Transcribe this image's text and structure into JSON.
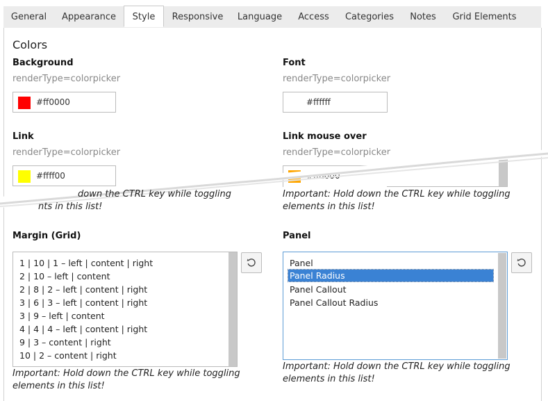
{
  "tabs": [
    {
      "label": "General"
    },
    {
      "label": "Appearance"
    },
    {
      "label": "Style"
    },
    {
      "label": "Responsive"
    },
    {
      "label": "Language"
    },
    {
      "label": "Access"
    },
    {
      "label": "Categories"
    },
    {
      "label": "Notes"
    },
    {
      "label": "Grid Elements"
    }
  ],
  "active_tab": "Style",
  "section": {
    "title": "Colors"
  },
  "fields": {
    "background": {
      "label": "Background",
      "hint": "renderType=colorpicker",
      "value": "#ff0000",
      "swatch": "#ff0000"
    },
    "font": {
      "label": "Font",
      "hint": "renderType=colorpicker",
      "value": "#ffffff",
      "swatch": "#ffffff"
    },
    "link": {
      "label": "Link",
      "hint": "renderType=colorpicker",
      "value": "#ffff00",
      "swatch": "#ffff00"
    },
    "link_hover": {
      "label": "Link mouse over",
      "hint": "renderType=colorpicker",
      "value": "#ffa600",
      "swatch": "#ffa600"
    }
  },
  "notes": {
    "partial_left_line1": "down the CTRL key while toggling",
    "partial_left_line2": "nts in this list!",
    "line1": "Important: Hold down the CTRL key while toggling",
    "line2": "elements in this list!"
  },
  "margin_grid": {
    "label": "Margin (Grid)",
    "options": [
      "1 | 10 | 1 – left | content | right",
      "2 | 10 – left | content",
      "2 | 8 | 2 – left | content | right",
      "3 | 6 | 3 – left | content | right",
      "3 | 9 – left | content",
      "4 | 4 | 4 – left | content | right",
      "9 | 3 – content | right",
      "10 | 2 – content | right"
    ]
  },
  "panel": {
    "label": "Panel",
    "options": [
      "Panel",
      "Panel Radius",
      "Panel Callout",
      "Panel Callout Radius"
    ],
    "selected": "Panel Radius"
  },
  "icons": {
    "reset": "undo-icon"
  }
}
